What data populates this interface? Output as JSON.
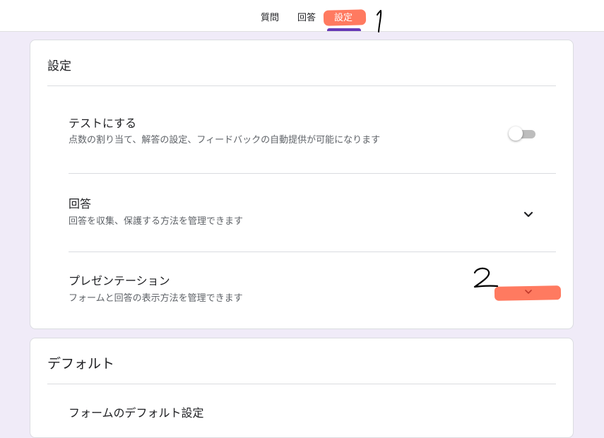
{
  "tabs": [
    {
      "label": "質問"
    },
    {
      "label": "回答"
    },
    {
      "label": "設定",
      "active": true
    }
  ],
  "settings_card": {
    "title": "設定",
    "rows": [
      {
        "title": "テストにする",
        "description": "点数の割り当て、解答の設定、フィードバックの自動提供が可能になります",
        "control": "toggle",
        "toggle_on": false
      },
      {
        "title": "回答",
        "description": "回答を収集、保護する方法を管理できます",
        "control": "chevron-down-icon"
      },
      {
        "title": "プレゼンテーション",
        "description": "フォームと回答の表示方法を管理できます",
        "control": "chevron-down-icon"
      }
    ]
  },
  "defaults_card": {
    "title": "デフォルト",
    "rows": [
      {
        "title": "フォームのデフォルト設定"
      }
    ]
  },
  "annotations": [
    {
      "text": "1",
      "color": "#000000"
    },
    {
      "text": "2",
      "color": "#000000"
    }
  ],
  "colors": {
    "accent": "#673ab7",
    "page_background": "#f0ebf8",
    "highlight": "#ff6f52",
    "toggle_off_track": "#bdbdbd",
    "secondary_text": "#5f6368"
  }
}
